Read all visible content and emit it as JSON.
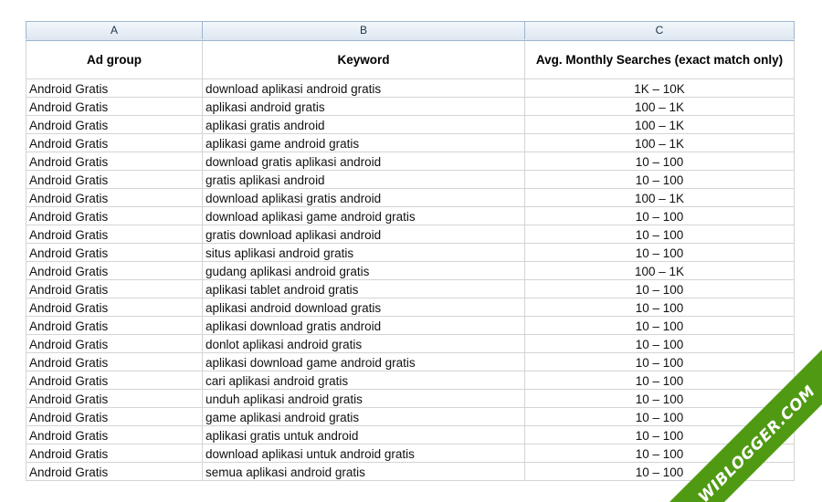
{
  "columns": [
    "A",
    "B",
    "C"
  ],
  "headers": {
    "ad_group": "Ad group",
    "keyword": "Keyword",
    "searches": "Avg. Monthly Searches (exact match only)"
  },
  "rows": [
    {
      "ad_group": "Android Gratis",
      "keyword": "download aplikasi android gratis",
      "searches": "1K – 10K"
    },
    {
      "ad_group": "Android Gratis",
      "keyword": "aplikasi android gratis",
      "searches": "100 – 1K"
    },
    {
      "ad_group": "Android Gratis",
      "keyword": "aplikasi gratis android",
      "searches": "100 – 1K"
    },
    {
      "ad_group": "Android Gratis",
      "keyword": "aplikasi game android gratis",
      "searches": "100 – 1K"
    },
    {
      "ad_group": "Android Gratis",
      "keyword": "download gratis aplikasi android",
      "searches": "10 – 100"
    },
    {
      "ad_group": "Android Gratis",
      "keyword": "gratis aplikasi android",
      "searches": "10 – 100"
    },
    {
      "ad_group": "Android Gratis",
      "keyword": "download aplikasi gratis android",
      "searches": "100 – 1K"
    },
    {
      "ad_group": "Android Gratis",
      "keyword": "download aplikasi game android gratis",
      "searches": "10 – 100"
    },
    {
      "ad_group": "Android Gratis",
      "keyword": "gratis download aplikasi android",
      "searches": "10 – 100"
    },
    {
      "ad_group": "Android Gratis",
      "keyword": "situs aplikasi android gratis",
      "searches": "10 – 100"
    },
    {
      "ad_group": "Android Gratis",
      "keyword": "gudang aplikasi android gratis",
      "searches": "100 – 1K"
    },
    {
      "ad_group": "Android Gratis",
      "keyword": "aplikasi tablet android gratis",
      "searches": "10 – 100"
    },
    {
      "ad_group": "Android Gratis",
      "keyword": "aplikasi android download gratis",
      "searches": "10 – 100"
    },
    {
      "ad_group": "Android Gratis",
      "keyword": "aplikasi download gratis android",
      "searches": "10 – 100"
    },
    {
      "ad_group": "Android Gratis",
      "keyword": "donlot aplikasi android gratis",
      "searches": "10 – 100"
    },
    {
      "ad_group": "Android Gratis",
      "keyword": "aplikasi download game android gratis",
      "searches": "10 – 100"
    },
    {
      "ad_group": "Android Gratis",
      "keyword": "cari aplikasi android gratis",
      "searches": "10 – 100"
    },
    {
      "ad_group": "Android Gratis",
      "keyword": "unduh aplikasi android gratis",
      "searches": "10 – 100"
    },
    {
      "ad_group": "Android Gratis",
      "keyword": "game aplikasi android gratis",
      "searches": "10 – 100"
    },
    {
      "ad_group": "Android Gratis",
      "keyword": "aplikasi gratis untuk android",
      "searches": "10 – 100"
    },
    {
      "ad_group": "Android Gratis",
      "keyword": "download aplikasi untuk android gratis",
      "searches": "10 – 100"
    },
    {
      "ad_group": "Android Gratis",
      "keyword": "semua aplikasi android gratis",
      "searches": "10 – 100"
    }
  ],
  "watermark": {
    "text": "WIBLOGGER.COM",
    "color": "#4f9a12"
  },
  "colors": {
    "header_bg": "#dde7f1",
    "header_border": "#9eb6ce",
    "grid": "#d4d4d4"
  }
}
